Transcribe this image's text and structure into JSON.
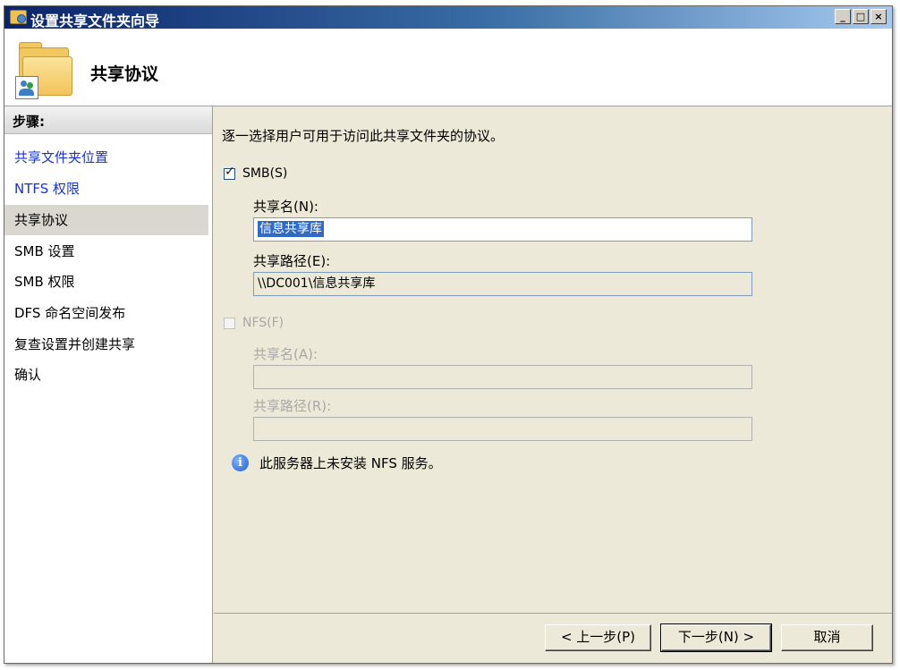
{
  "window": {
    "title": "设置共享文件夹向导",
    "minimize_glyph": "_",
    "maximize_glyph": "□",
    "close_glyph": "×"
  },
  "header": {
    "title": "共享协议",
    "icon": "shared-folder-icon"
  },
  "sidebar": {
    "header": "步骤:",
    "items": [
      {
        "label": "共享文件夹位置",
        "state": "completed"
      },
      {
        "label": "NTFS 权限",
        "state": "completed"
      },
      {
        "label": "共享协议",
        "state": "current"
      },
      {
        "label": "SMB 设置",
        "state": "pending"
      },
      {
        "label": "SMB 权限",
        "state": "pending"
      },
      {
        "label": "DFS 命名空间发布",
        "state": "pending"
      },
      {
        "label": "复查设置并创建共享",
        "state": "pending"
      },
      {
        "label": "确认",
        "state": "pending"
      }
    ]
  },
  "main": {
    "instruction": "逐一选择用户可用于访问此共享文件夹的协议。",
    "smb": {
      "label": "SMB(S)",
      "checked": true,
      "share_name_label": "共享名(N):",
      "share_name_value": "信息共享库",
      "share_path_label": "共享路径(E):",
      "share_path_value": "\\\\DC001\\信息共享库"
    },
    "nfs": {
      "label": "NFS(F)",
      "checked": false,
      "enabled": false,
      "share_name_label": "共享名(A):",
      "share_name_value": "",
      "share_path_label": "共享路径(R):",
      "share_path_value": ""
    },
    "info": {
      "icon": "info-icon",
      "text": "此服务器上未安装 NFS 服务。"
    }
  },
  "footer": {
    "back_label": "< 上一步(P)",
    "next_label": "下一步(N) >",
    "cancel_label": "取消"
  }
}
